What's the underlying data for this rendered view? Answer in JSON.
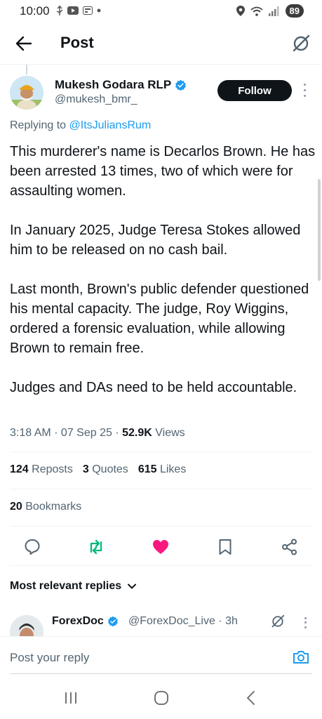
{
  "status_bar": {
    "time": "10:00",
    "battery": "89"
  },
  "header": {
    "title": "Post"
  },
  "tweet": {
    "author_name": "Mukesh Godara RLP",
    "author_handle": "@mukesh_bmr_",
    "follow_label": "Follow",
    "replying_prefix": "Replying to",
    "replying_to": "@ItsJuliansRum",
    "paragraphs": [
      "This murderer's name is Decarlos Brown. He has been arrested 13 times, two of which were for assaulting women.",
      "In January 2025, Judge Teresa Stokes allowed him to be released on no cash bail.",
      "Last month, Brown's public defender questioned his mental capacity. The judge, Roy Wiggins, ordered a forensic evaluation, while allowing Brown to remain free.",
      "Judges and DAs need to be held accountable."
    ],
    "time": "3:18 AM",
    "date": "07 Sep 25",
    "views_count": "52.9K",
    "views_label": "Views",
    "reposts_count": "124",
    "reposts_label": "Reposts",
    "quotes_count": "3",
    "quotes_label": "Quotes",
    "likes_count": "615",
    "likes_label": "Likes",
    "bookmarks_count": "20",
    "bookmarks_label": "Bookmarks"
  },
  "replies": {
    "header": "Most relevant replies",
    "first": {
      "name": "ForexDoc",
      "handle": "@ForexDoc_Live",
      "time": "3h"
    }
  },
  "reply_bar": {
    "placeholder": "Post your reply"
  },
  "colors": {
    "accent": "#1d9bf0",
    "repost_green": "#00ba7c",
    "like_pink": "#f91880",
    "text": "#0f1419",
    "secondary": "#536471"
  },
  "icons": {
    "back": "arrow-left-icon",
    "grok": "grok-icon",
    "verified": "verified-badge-icon",
    "reply": "speech-bubble-icon",
    "repost": "repost-icon",
    "like": "heart-icon",
    "bookmark": "bookmark-icon",
    "share": "share-icon",
    "camera": "camera-icon"
  }
}
